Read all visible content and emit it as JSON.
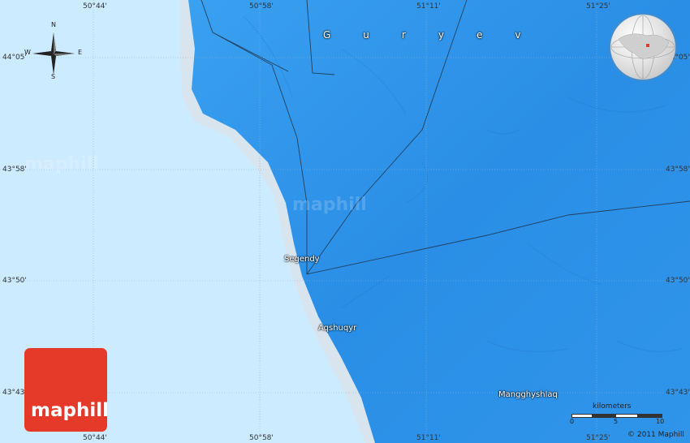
{
  "map": {
    "region_label": "Guryev",
    "cities": [
      {
        "name": "Segendy"
      },
      {
        "name": "Aqshuqyr"
      },
      {
        "name": "Mangghyshlaq"
      }
    ],
    "coordinates": {
      "top": [
        "50°44'",
        "50°58'",
        "51°11'",
        "51°25'"
      ],
      "bottom": [
        "50°44'",
        "50°58'",
        "51°11'",
        "51°25'"
      ],
      "left": [
        "44°05'",
        "43°58'",
        "43°50'",
        "43°43'"
      ],
      "right": [
        "44°05'",
        "43°58'",
        "43°50'",
        "43°43'"
      ]
    },
    "compass": {
      "n": "N",
      "s": "S",
      "e": "E",
      "w": "W"
    },
    "scale": {
      "label": "kilometers",
      "ticks": [
        "0",
        "5",
        "10"
      ]
    },
    "copyright": "© 2011 Maphill",
    "logo_text": "maphill",
    "watermark_text": "maphill",
    "colors": {
      "sea": "#cdebff",
      "land": "#2f93e8",
      "shore": "#d8e4ee",
      "logo": "#e53a2a"
    }
  }
}
